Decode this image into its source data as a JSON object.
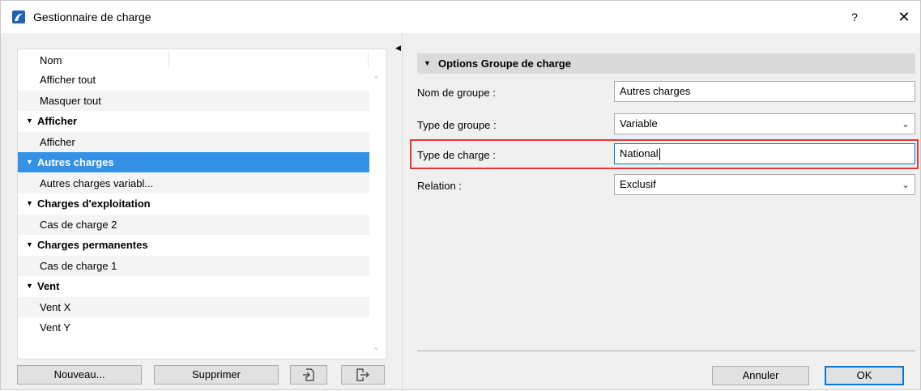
{
  "window": {
    "title": "Gestionnaire de charge",
    "help": "?",
    "close": "✕"
  },
  "list": {
    "column_header": "Nom",
    "rows": [
      {
        "label": "Afficher tout",
        "kind": "leaf"
      },
      {
        "label": "Masquer tout",
        "kind": "leaf"
      },
      {
        "label": "Afficher",
        "kind": "group"
      },
      {
        "label": "Afficher",
        "kind": "leaf"
      },
      {
        "label": "Autres charges",
        "kind": "group",
        "selected": true
      },
      {
        "label": "Autres charges variabl...",
        "kind": "leaf"
      },
      {
        "label": "Charges d'exploitation",
        "kind": "group"
      },
      {
        "label": "Cas de charge 2",
        "kind": "leaf"
      },
      {
        "label": "Charges permanentes",
        "kind": "group"
      },
      {
        "label": "Cas de charge 1",
        "kind": "leaf"
      },
      {
        "label": "Vent",
        "kind": "group"
      },
      {
        "label": "Vent X",
        "kind": "leaf"
      },
      {
        "label": "Vent Y",
        "kind": "leaf"
      }
    ]
  },
  "buttons": {
    "new": "Nouveau...",
    "delete": "Supprimer",
    "cancel": "Annuler",
    "ok": "OK"
  },
  "options": {
    "section_title": "Options Groupe de charge",
    "group_name_label": "Nom de groupe :",
    "group_name_value": "Autres charges",
    "group_type_label": "Type de groupe :",
    "group_type_value": "Variable",
    "load_type_label": "Type de charge :",
    "load_type_value": "National",
    "relation_label": "Relation :",
    "relation_value": "Exclusif"
  },
  "colors": {
    "selection": "#3392e6",
    "highlight": "#e53935",
    "primary_border": "#0078d7"
  }
}
